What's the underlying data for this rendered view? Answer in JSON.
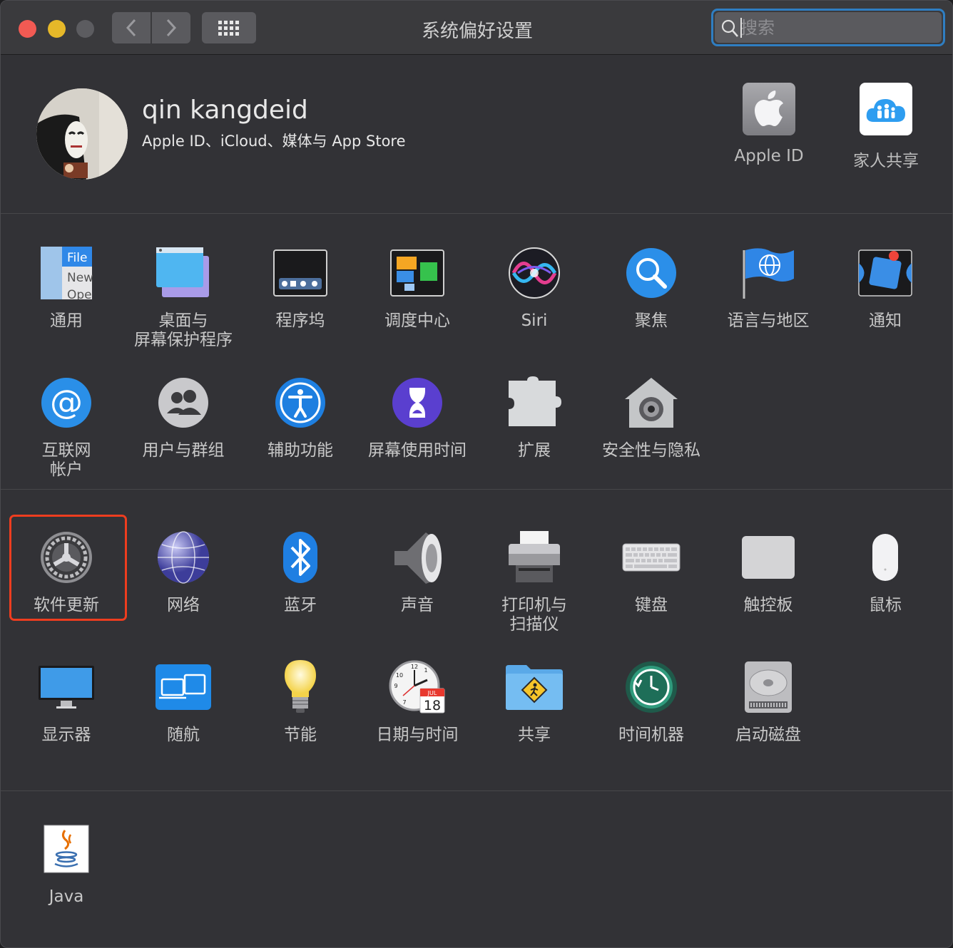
{
  "window": {
    "title": "系统偏好设置",
    "search_placeholder": "搜索"
  },
  "account": {
    "name": "qin kangdeid",
    "subtitle": "Apple ID、iCloud、媒体与 App Store",
    "items": [
      {
        "label": "Apple ID",
        "icon": "apple-logo-icon"
      },
      {
        "label": "家人共享",
        "icon": "family-sharing-icon"
      }
    ]
  },
  "section1": {
    "row1": [
      {
        "label": "通用",
        "icon": "general-icon"
      },
      {
        "label": "桌面与\n屏幕保护程序",
        "icon": "desktop-screensaver-icon"
      },
      {
        "label": "程序坞",
        "icon": "dock-icon"
      },
      {
        "label": "调度中心",
        "icon": "mission-control-icon"
      },
      {
        "label": "Siri",
        "icon": "siri-icon"
      },
      {
        "label": "聚焦",
        "icon": "spotlight-icon"
      },
      {
        "label": "语言与地区",
        "icon": "language-region-icon"
      },
      {
        "label": "通知",
        "icon": "notifications-icon"
      }
    ],
    "row2": [
      {
        "label": "互联网\n帐户",
        "icon": "internet-accounts-icon"
      },
      {
        "label": "用户与群组",
        "icon": "users-groups-icon"
      },
      {
        "label": "辅助功能",
        "icon": "accessibility-icon"
      },
      {
        "label": "屏幕使用时间",
        "icon": "screen-time-icon"
      },
      {
        "label": "扩展",
        "icon": "extensions-icon"
      },
      {
        "label": "安全性与隐私",
        "icon": "security-privacy-icon"
      }
    ]
  },
  "section2": {
    "row1": [
      {
        "label": "软件更新",
        "icon": "software-update-icon"
      },
      {
        "label": "网络",
        "icon": "network-icon"
      },
      {
        "label": "蓝牙",
        "icon": "bluetooth-icon"
      },
      {
        "label": "声音",
        "icon": "sound-icon"
      },
      {
        "label": "打印机与\n扫描仪",
        "icon": "printer-scanner-icon"
      },
      {
        "label": "键盘",
        "icon": "keyboard-icon"
      },
      {
        "label": "触控板",
        "icon": "trackpad-icon"
      },
      {
        "label": "鼠标",
        "icon": "mouse-icon"
      }
    ],
    "row2": [
      {
        "label": "显示器",
        "icon": "displays-icon"
      },
      {
        "label": "随航",
        "icon": "sidecar-icon"
      },
      {
        "label": "节能",
        "icon": "energy-saver-icon"
      },
      {
        "label": "日期与时间",
        "icon": "date-time-icon"
      },
      {
        "label": "共享",
        "icon": "sharing-icon"
      },
      {
        "label": "时间机器",
        "icon": "time-machine-icon"
      },
      {
        "label": "启动磁盘",
        "icon": "startup-disk-icon"
      }
    ]
  },
  "section3": {
    "row1": [
      {
        "label": "Java",
        "icon": "java-icon"
      }
    ]
  },
  "general_icon_text": [
    "File",
    "New",
    "Ope"
  ],
  "calendar": {
    "month": "JUL",
    "day": "18"
  },
  "clock_numbers": [
    "12",
    "1",
    "10",
    "9",
    "7"
  ],
  "colors": {
    "highlight": "#ee3d1f",
    "search_focus": "#2f7ec2",
    "background": "#323236"
  }
}
